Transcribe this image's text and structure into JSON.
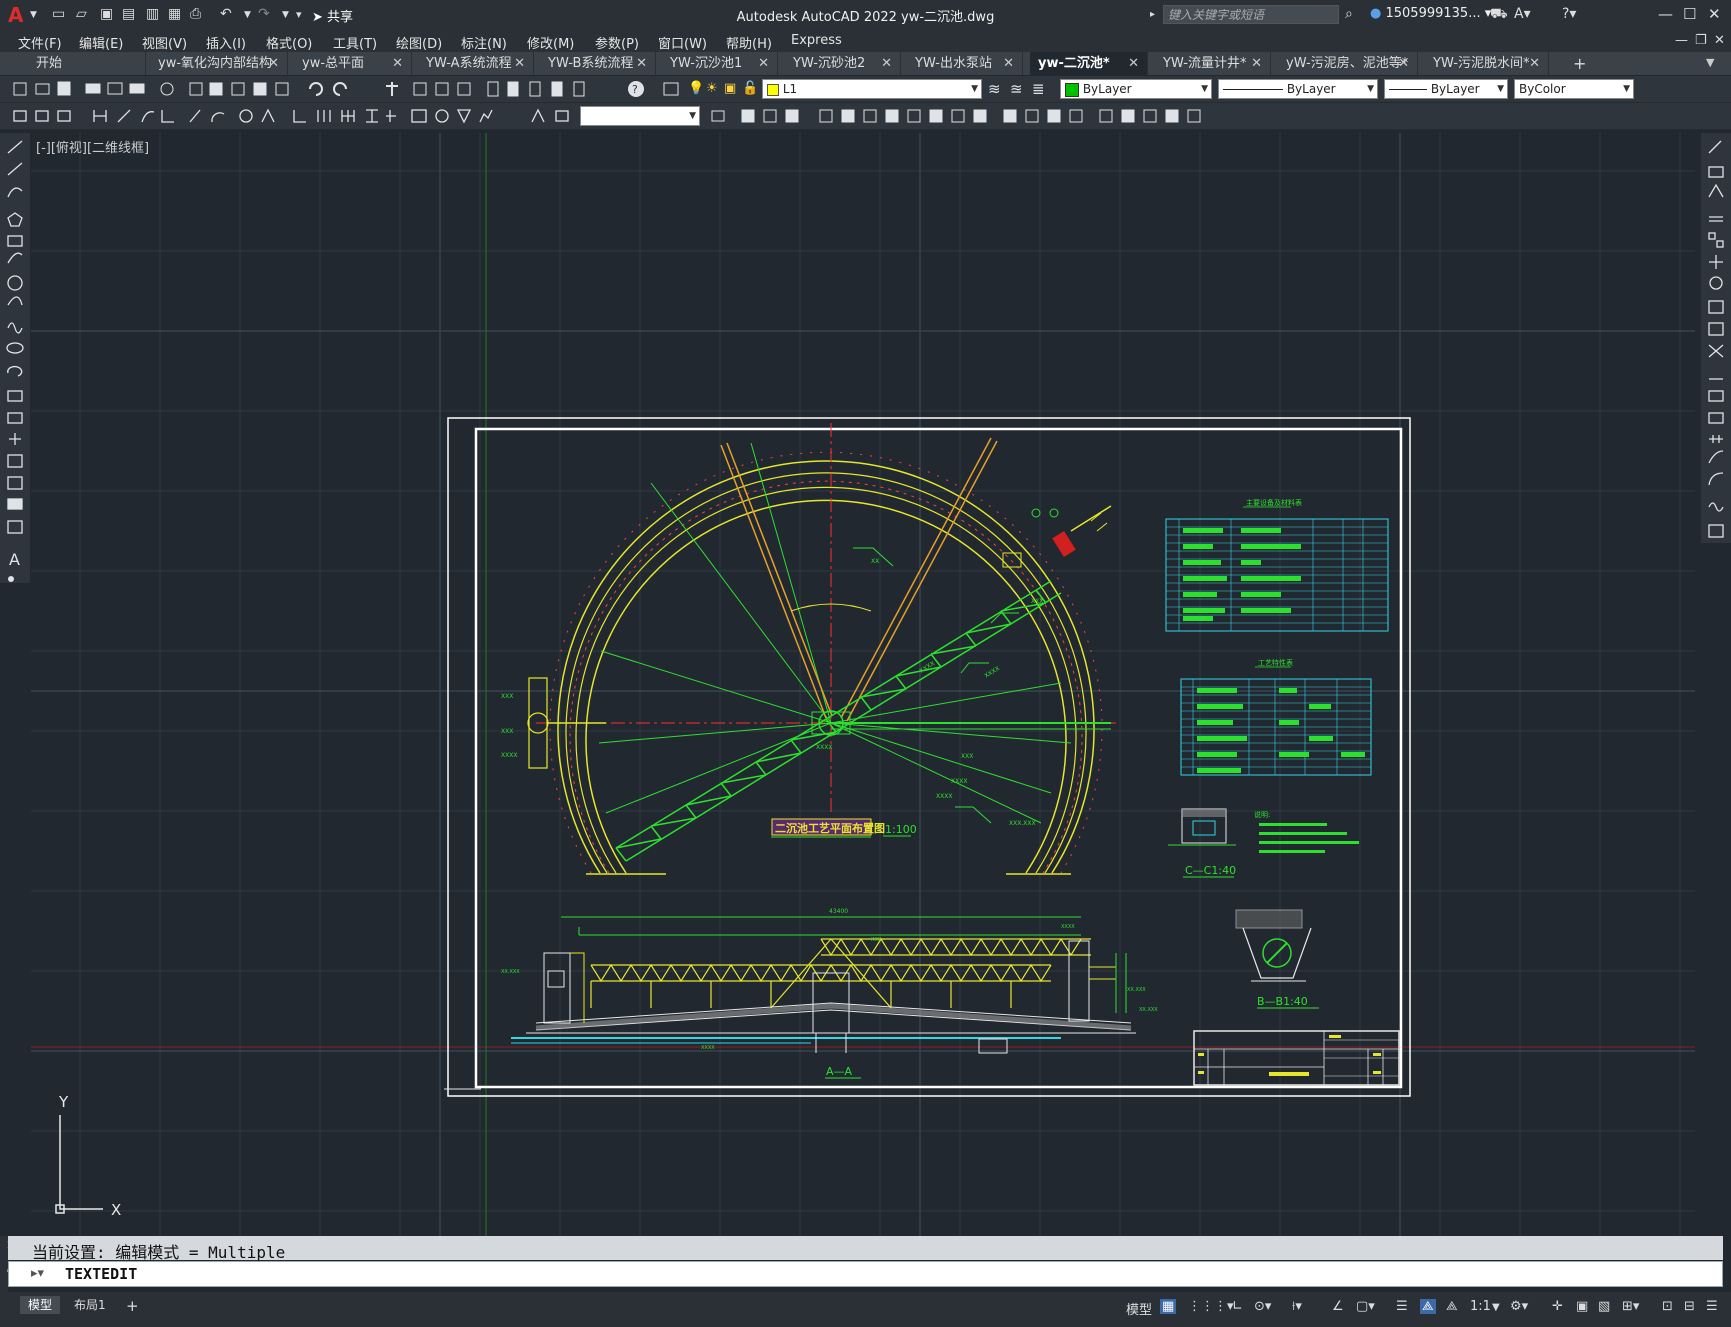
{
  "titlebar": {
    "app_title": "Autodesk AutoCAD 2022    yw-二沉池.dwg",
    "share_label": "共享",
    "search_placeholder": "键入关键字或短语",
    "user_name": "1505999135..."
  },
  "menubar": {
    "items": [
      "文件(F)",
      "编辑(E)",
      "视图(V)",
      "插入(I)",
      "格式(O)",
      "工具(T)",
      "绘图(D)",
      "标注(N)",
      "修改(M)",
      "参数(P)",
      "窗口(W)",
      "帮助(H)",
      "Express"
    ]
  },
  "tabs": [
    {
      "label": "开始"
    },
    {
      "label": "yw-氧化沟内部结构"
    },
    {
      "label": "yw-总平面"
    },
    {
      "label": "YW-A系统流程"
    },
    {
      "label": "YW-B系统流程"
    },
    {
      "label": "YW-沉沙池1"
    },
    {
      "label": "YW-沉砂池2"
    },
    {
      "label": "YW-出水泵站"
    },
    {
      "label": "yw-二沉池*"
    },
    {
      "label": "YW-流量计井*"
    },
    {
      "label": "yW-污泥房、泥池等*"
    },
    {
      "label": "YW-污泥脱水间*"
    }
  ],
  "properties": {
    "layer": "L1",
    "color": "ByLayer",
    "linetype": "ByLayer",
    "lineweight": "ByLayer",
    "plotstyle": "ByColor",
    "layer_color": "#ffff00",
    "color_swatch": "#00c000"
  },
  "viewport": {
    "label": "[-][俯视][二维线框]"
  },
  "drawing": {
    "plan_title": "二沉池工艺平面布置图",
    "plan_scale": "1:100",
    "section_aa": "A—A",
    "section_bb": "B—B1:40",
    "section_cc": "C—C1:40",
    "table1_title": "主要设备及材料表",
    "table2_title": "工艺特性表",
    "notes_title": "说明:",
    "dim_total": "43400"
  },
  "command": {
    "history": "当前设置: 编辑模式 = Multiple",
    "input": "TEXTEDIT"
  },
  "status": {
    "layout_tabs": [
      "模型",
      "布局1"
    ],
    "model_label": "模型",
    "scale": "1:1"
  }
}
